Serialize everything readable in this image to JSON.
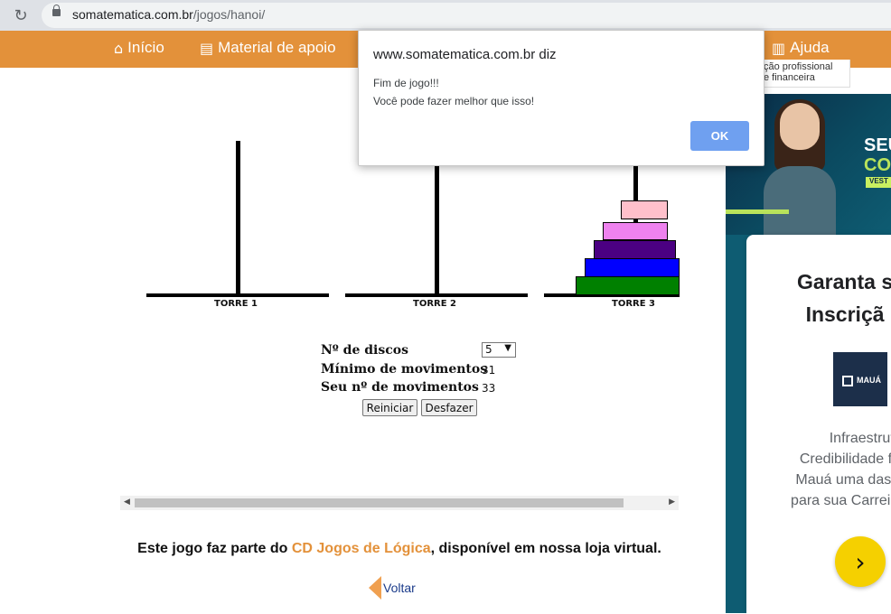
{
  "browser": {
    "url_host": "somatematica.com.br",
    "url_path": "/jogos/hanoi/"
  },
  "nav": {
    "items": [
      {
        "label": "Início",
        "icon": "home-icon"
      },
      {
        "label": "Material de apoio",
        "icon": "document-icon"
      },
      {
        "label": "Ajuda",
        "icon": "book-icon"
      }
    ]
  },
  "game": {
    "towers": [
      "TORRE 1",
      "TORRE 2",
      "TORRE 3"
    ],
    "tower3_disks": 5,
    "disk_colors": [
      "#ffc0cb",
      "#ee82ee",
      "#4b0082",
      "#0000ff",
      "#008000"
    ],
    "form": {
      "disks_label": "Nº de discos",
      "disks_value": "5",
      "min_moves_label": "Mínimo de movimentos",
      "min_moves_value": "31",
      "your_moves_label": "Seu nº de movimentos",
      "your_moves_value": "33",
      "restart_label": "Reiniciar",
      "undo_label": "Desfazer"
    }
  },
  "footer": {
    "text_before": "Este jogo faz parte do ",
    "link": "CD Jogos de Lógica",
    "text_after": ", disponível em nossa loja virtual.",
    "back_label": "Voltar"
  },
  "ad": {
    "snippet_line1": "ção profissional",
    "snippet_line2": "e financeira",
    "headline_1": "SEU",
    "headline_2": "COM",
    "badge": "VEST",
    "title_line1": "Garanta s",
    "title_line2": "Inscriçã",
    "logo_text": "MAUÁ",
    "body_lines": [
      "Infraestrutur",
      "Credibilidade faz",
      "Mauá uma das m",
      "para sua Carreira."
    ],
    "cta_icon": "chevron-right-icon"
  },
  "dialog": {
    "origin": "www.somatematica.com.br diz",
    "message_line1": "Fim de jogo!!!",
    "message_line2": "Você pode fazer melhor que isso!",
    "ok_label": "OK"
  },
  "colors": {
    "nav": "#e3913a",
    "link": "#e3913a",
    "ok": "#6fa0f0"
  }
}
